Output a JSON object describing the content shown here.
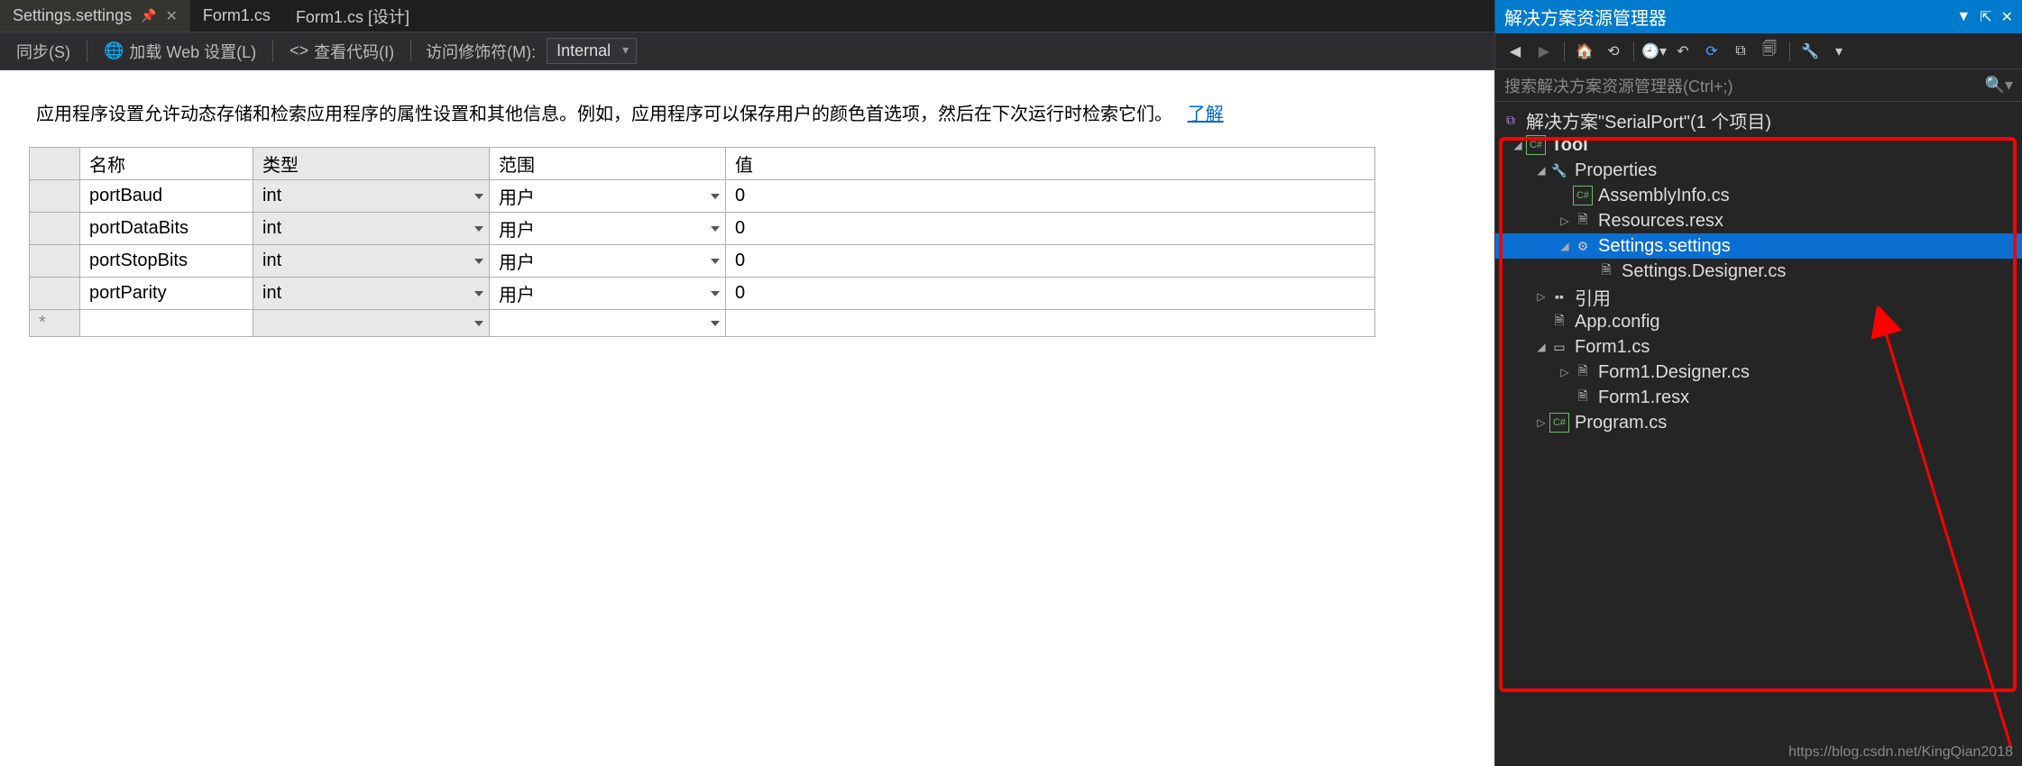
{
  "tabs": [
    {
      "label": "Settings.settings",
      "active": true,
      "pinned": true,
      "closable": true
    },
    {
      "label": "Form1.cs",
      "active": false,
      "pinned": false,
      "closable": false
    },
    {
      "label": "Form1.cs [设计]",
      "active": false,
      "pinned": false,
      "closable": false
    }
  ],
  "toolbar": {
    "sync": "同步(S)",
    "load_web": "加载 Web 设置(L)",
    "view_code": "查看代码(I)",
    "modifier_label": "访问修饰符(M):",
    "modifier_value": "Internal"
  },
  "intro_text": "应用程序设置允许动态存储和检索应用程序的属性设置和其他信息。例如，应用程序可以保存用户的颜色首选项，然后在下次运行时检索它们。",
  "intro_link": "了解",
  "grid": {
    "headers": {
      "name": "名称",
      "type": "类型",
      "scope": "范围",
      "value": "值"
    },
    "rows": [
      {
        "name": "portBaud",
        "type": "int",
        "scope": "用户",
        "value": "0"
      },
      {
        "name": "portDataBits",
        "type": "int",
        "scope": "用户",
        "value": "0"
      },
      {
        "name": "portStopBits",
        "type": "int",
        "scope": "用户",
        "value": "0"
      },
      {
        "name": "portParity",
        "type": "int",
        "scope": "用户",
        "value": "0"
      }
    ],
    "new_marker": "*"
  },
  "panel": {
    "title": "解决方案资源管理器",
    "search_placeholder": "搜索解决方案资源管理器(Ctrl+;)",
    "tree": {
      "solution": "解决方案\"SerialPort\"(1 个项目)",
      "project": "Tool",
      "properties": "Properties",
      "assembly": "AssemblyInfo.cs",
      "resources": "Resources.resx",
      "settings": "Settings.settings",
      "settings_designer": "Settings.Designer.cs",
      "references": "引用",
      "appconfig": "App.config",
      "form": "Form1.cs",
      "form_designer": "Form1.Designer.cs",
      "form_resx": "Form1.resx",
      "program": "Program.cs"
    }
  },
  "footer_url": "https://blog.csdn.net/KingQian2018"
}
